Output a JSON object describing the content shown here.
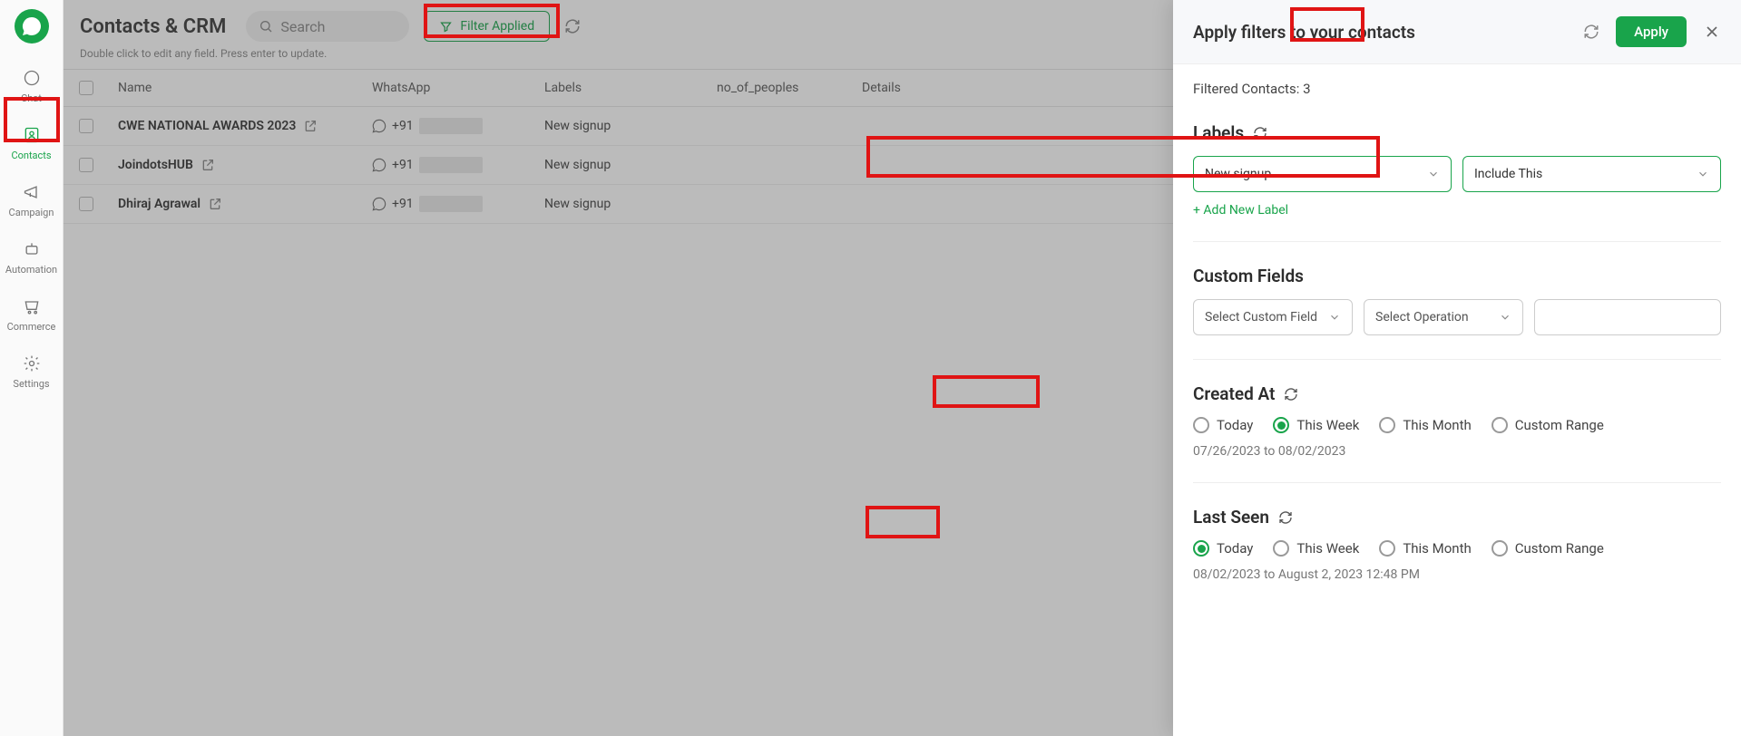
{
  "sidebar": {
    "items": [
      {
        "label": "Chat"
      },
      {
        "label": "Contacts"
      },
      {
        "label": "Campaign"
      },
      {
        "label": "Automation"
      },
      {
        "label": "Commerce"
      },
      {
        "label": "Settings"
      }
    ]
  },
  "header": {
    "title": "Contacts & CRM",
    "search_placeholder": "Search",
    "filter_button": "Filter Applied",
    "subhint": "Double click to edit any field. Press enter to update."
  },
  "columns": {
    "name": "Name",
    "whatsapp": "WhatsApp",
    "labels": "Labels",
    "nop": "no_of_peoples",
    "details": "Details"
  },
  "rows": [
    {
      "name": "CWE NATIONAL AWARDS 2023",
      "phone_prefix": "+91",
      "label": "New signup"
    },
    {
      "name": "JoindotsHUB",
      "phone_prefix": "+91",
      "label": "New signup"
    },
    {
      "name": "Dhiraj Agrawal",
      "phone_prefix": "+91",
      "label": "New signup"
    }
  ],
  "panel": {
    "title": "Apply filters to your contacts",
    "apply": "Apply",
    "filtered_label": "Filtered Contacts:",
    "filtered_count": "3",
    "labels_section": "Labels",
    "label_value": "New signup",
    "include_value": "Include This",
    "add_label": "+ Add New Label",
    "custom_fields_section": "Custom Fields",
    "custom_field_placeholder": "Select Custom Field",
    "operation_placeholder": "Select Operation",
    "created_section": "Created At",
    "radio": {
      "today": "Today",
      "week": "This Week",
      "month": "This Month",
      "custom": "Custom Range"
    },
    "created_range": "07/26/2023 to 08/02/2023",
    "lastseen_section": "Last Seen",
    "lastseen_range": "08/02/2023 to August 2, 2023 12:48 PM"
  }
}
